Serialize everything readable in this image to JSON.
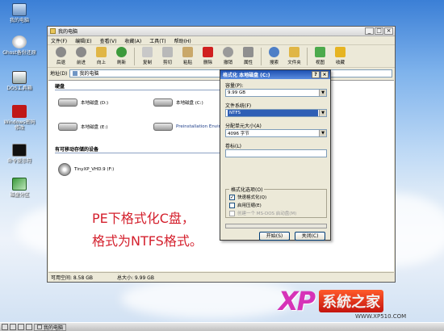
{
  "desktop": {
    "icons": [
      {
        "label": "我的电脑"
      },
      {
        "label": "Ghost备份还原"
      },
      {
        "label": "DOS工具箱"
      },
      {
        "label": "Windows密码修改"
      },
      {
        "label": "命令提示符"
      },
      {
        "label": "磁盘分区"
      }
    ]
  },
  "window": {
    "title": "我的电脑",
    "menu": [
      "文件(F)",
      "编辑(E)",
      "查看(V)",
      "收藏(A)",
      "工具(T)",
      "帮助(H)"
    ],
    "toolbar": {
      "back": "后退",
      "forward": "前进",
      "up": "向上",
      "refresh": "刷新",
      "copy": "复制",
      "cut": "剪切",
      "paste": "粘贴",
      "delete": "删除",
      "undo": "撤销",
      "properties": "属性",
      "search": "搜索",
      "folders": "文件夹",
      "views": "视图",
      "favorites": "收藏"
    },
    "address_label": "地址(D)",
    "address_value": "我的电脑",
    "groups": {
      "hard_disks": "硬盘",
      "removable": "有可移动存储的设备"
    },
    "drives": [
      {
        "label": "本地磁盘 (D:)"
      },
      {
        "label": "本地磁盘 (C:)"
      },
      {
        "label": "本地磁盘 (E:)"
      },
      {
        "label": "Preinstallation Environ..."
      }
    ],
    "removable_drive": {
      "label": "TinyXP_VHD.9 (F:)"
    },
    "status": {
      "free": "可用空间: 8.58 GB",
      "total": "总大小: 9.99 GB"
    }
  },
  "caption": {
    "line1": "PE下格式化C盘，",
    "line2": "格式为NTFS格式。"
  },
  "dialog": {
    "title": "格式化 本地磁盘 (C:)",
    "capacity_label": "容量(P):",
    "capacity_value": "9.99 GB",
    "fs_label": "文件系统(F)",
    "fs_value": "NTFS",
    "unit_label": "分配单元大小(A)",
    "unit_value": "4096 字节",
    "volume_label": "卷标(L)",
    "volume_value": "",
    "options_label": "格式化选项(O)",
    "options": [
      {
        "label": "快速格式化(Q)",
        "checked": true,
        "enabled": true
      },
      {
        "label": "启用压缩(E)",
        "checked": false,
        "enabled": true
      },
      {
        "label": "创建一个 MS-DOS 启动盘(M)",
        "checked": false,
        "enabled": false
      }
    ],
    "start_button": "开始(S)",
    "close_button": "关闭(C)"
  },
  "taskbar": {
    "window_button": "我的电脑"
  },
  "watermark": {
    "xp": "XP",
    "brand": "系統之家",
    "url": "WWW.XP510.COM"
  }
}
